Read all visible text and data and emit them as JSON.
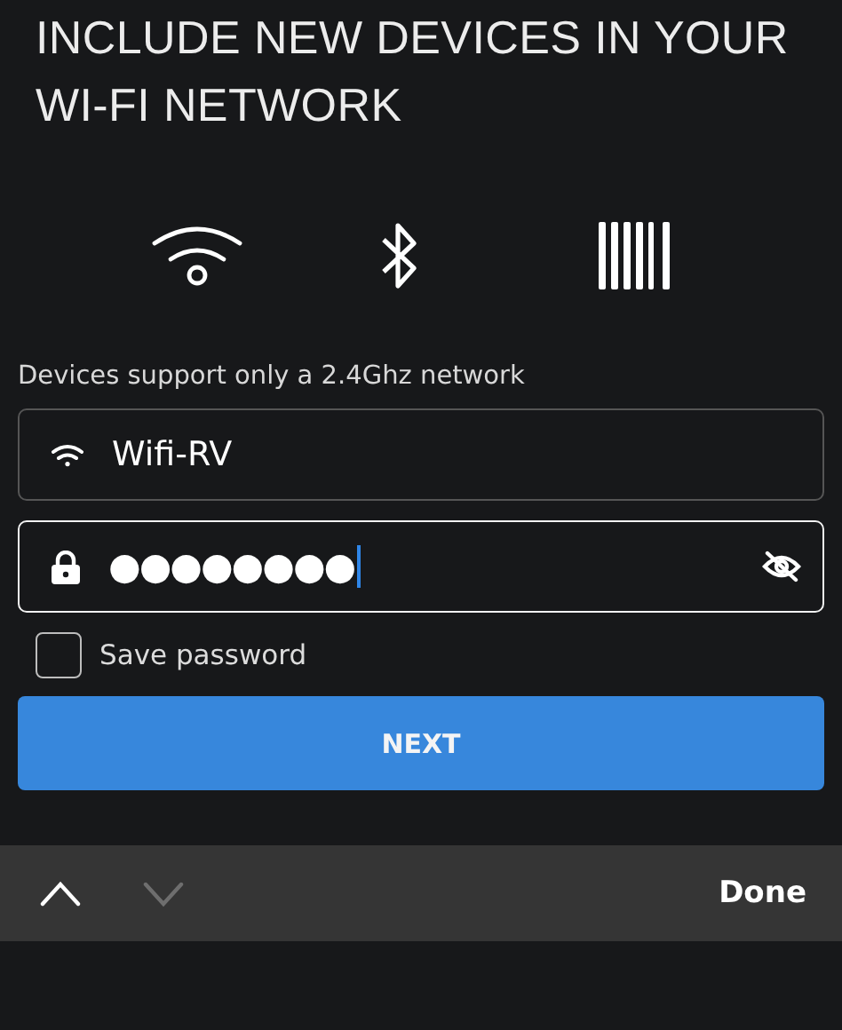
{
  "title": "INCLUDE NEW DEVICES IN YOUR WI-FI NETWORK",
  "methods": [
    {
      "kind": "wifi"
    },
    {
      "kind": "bluetooth"
    },
    {
      "kind": "barcode"
    }
  ],
  "hint": "Devices support only a 2.4Ghz network",
  "fields": [
    {
      "kind": "network",
      "value": "Wifi-RV",
      "focused": false
    },
    {
      "kind": "password",
      "value": "●●●●●●●●",
      "focused": true,
      "show_password": false
    }
  ],
  "save_password": {
    "label": "Save password",
    "checked": false
  },
  "next_button": "NEXT",
  "keyboard_bar": {
    "previous": {
      "disabled": false
    },
    "next": {
      "disabled": true
    },
    "done": "Done"
  }
}
